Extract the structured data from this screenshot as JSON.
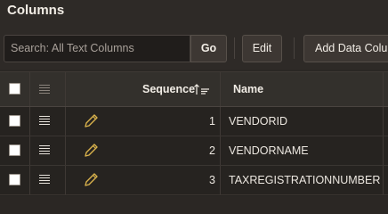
{
  "region": {
    "title": "Columns"
  },
  "toolbar": {
    "search_placeholder": "Search: All Text Columns",
    "go_label": "Go",
    "edit_label": "Edit",
    "add_label": "Add Data Colur"
  },
  "grid": {
    "headers": {
      "sequence": "Sequence",
      "name": "Name"
    },
    "sort": {
      "column": "Sequence",
      "direction": "ascending"
    },
    "rows": [
      {
        "sequence": "1",
        "name": "VENDORID"
      },
      {
        "sequence": "2",
        "name": "VENDORNAME"
      },
      {
        "sequence": "3",
        "name": "TAXREGISTRATIONNUMBER"
      }
    ]
  },
  "colors": {
    "background": "#2b2724",
    "grid_header": "#33302c",
    "pencil": "#d9b24c",
    "text": "#e8e3dc"
  },
  "icons": {
    "row_edit": "pencil-icon",
    "row_menu": "hamburger-icon",
    "sort": "sort-ascending-icon"
  }
}
